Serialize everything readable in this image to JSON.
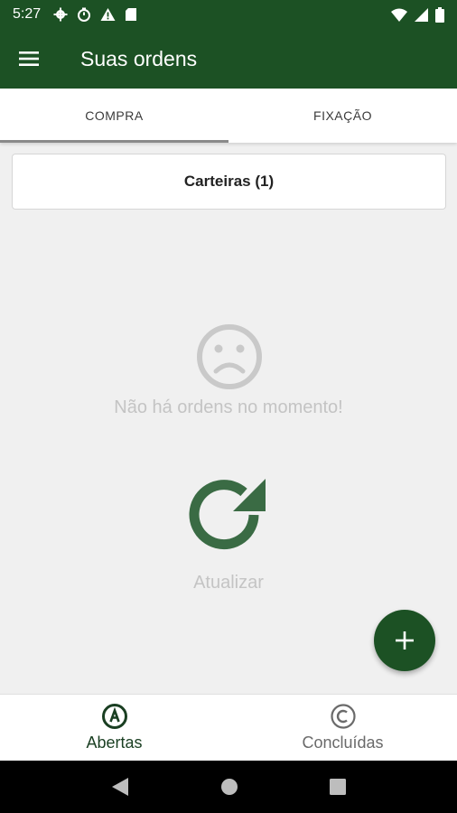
{
  "status_bar": {
    "time": "5:27",
    "left_icons": [
      "gear-icon",
      "timer-icon",
      "warning-icon",
      "sd-card-icon"
    ],
    "right_icons": [
      "wifi-icon",
      "signal-icon",
      "battery-icon"
    ]
  },
  "app_bar": {
    "menu_icon": "hamburger-menu-icon",
    "title": "Suas ordens",
    "color": "#1c5124"
  },
  "tabs": [
    {
      "label": "COMPRA",
      "active": true
    },
    {
      "label": "FIXAÇÃO",
      "active": false
    }
  ],
  "wallet_button": {
    "label": "Carteiras (1)"
  },
  "empty_state": {
    "icon": "sad-face-icon",
    "message": "Não há ordens no momento!"
  },
  "refresh": {
    "icon": "refresh-icon",
    "label": "Atualizar",
    "color": "#3a6b44"
  },
  "fab": {
    "icon": "plus-icon"
  },
  "bottom_nav": [
    {
      "icon": "circled-a-icon",
      "label": "Abertas",
      "active": true
    },
    {
      "icon": "circled-c-icon",
      "label": "Concluídas",
      "active": false
    }
  ],
  "system_nav": [
    "back-icon",
    "home-icon",
    "recents-icon"
  ]
}
